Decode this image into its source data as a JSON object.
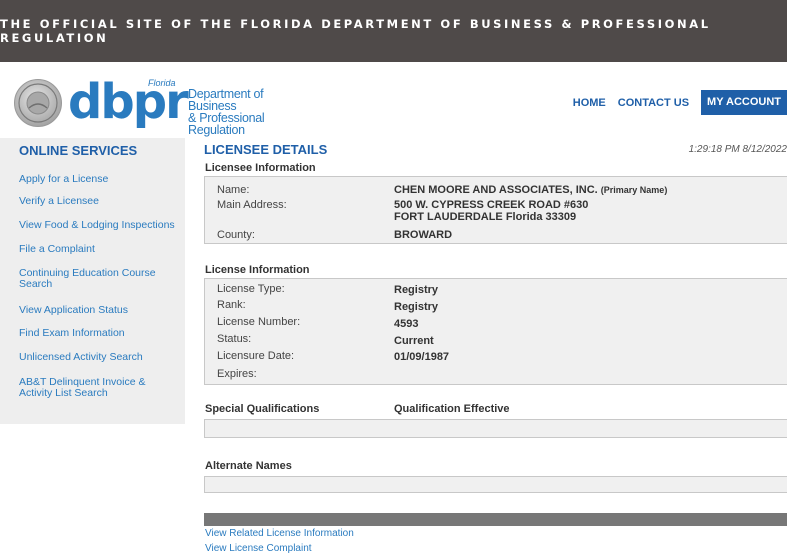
{
  "banner": {
    "text": "THE OFFICIAL SITE OF THE FLORIDA DEPARTMENT OF BUSINESS & PROFESSIONAL REGULATION"
  },
  "logo": {
    "florida": "Florida",
    "dbpr": "dbpr",
    "dept_line1": "Department of Business",
    "dept_line2": "& Professional Regulation"
  },
  "nav": {
    "home": "HOME",
    "contact": "CONTACT US",
    "account": "MY ACCOUNT"
  },
  "sidebar": {
    "title": "ONLINE SERVICES",
    "items": [
      "Apply for a License",
      "Verify a Licensee",
      "View Food & Lodging Inspections",
      "File a Complaint",
      "Continuing Education Course Search",
      "View Application Status",
      "Find Exam Information",
      "Unlicensed Activity Search",
      "AB&T Delinquent Invoice & Activity List Search"
    ]
  },
  "main": {
    "title": "LICENSEE DETAILS",
    "timestamp": "1:29:18 PM 8/12/2022",
    "licensee": {
      "heading": "Licensee Information",
      "name_label": "Name:",
      "name_value": "CHEN MOORE AND ASSOCIATES, INC.",
      "primary_tag": "(Primary Name)",
      "address_label": "Main Address:",
      "address_line1": "500 W. CYPRESS CREEK ROAD #630",
      "address_line2": "FORT LAUDERDALE  Florida  33309",
      "county_label": "County:",
      "county_value": "BROWARD"
    },
    "license": {
      "heading": "License Information",
      "type_label": "License Type:",
      "type_value": "Registry",
      "rank_label": "Rank:",
      "rank_value": "Registry",
      "number_label": "License Number:",
      "number_value": "4593",
      "status_label": "Status:",
      "status_value": "Current",
      "date_label": "Licensure Date:",
      "date_value": "01/09/1987",
      "expires_label": "Expires:",
      "expires_value": ""
    },
    "special": {
      "heading": "Special Qualifications",
      "effective_heading": "Qualification Effective"
    },
    "alternate": {
      "heading": "Alternate Names"
    },
    "links": {
      "related": "View Related License Information",
      "complaint": "View License Complaint"
    }
  },
  "colors": {
    "banner": "#4f4a49",
    "brand_blue": "#1f5fa8",
    "link_blue": "#2a7bbf",
    "sidebar_bg": "#eeeeee"
  }
}
